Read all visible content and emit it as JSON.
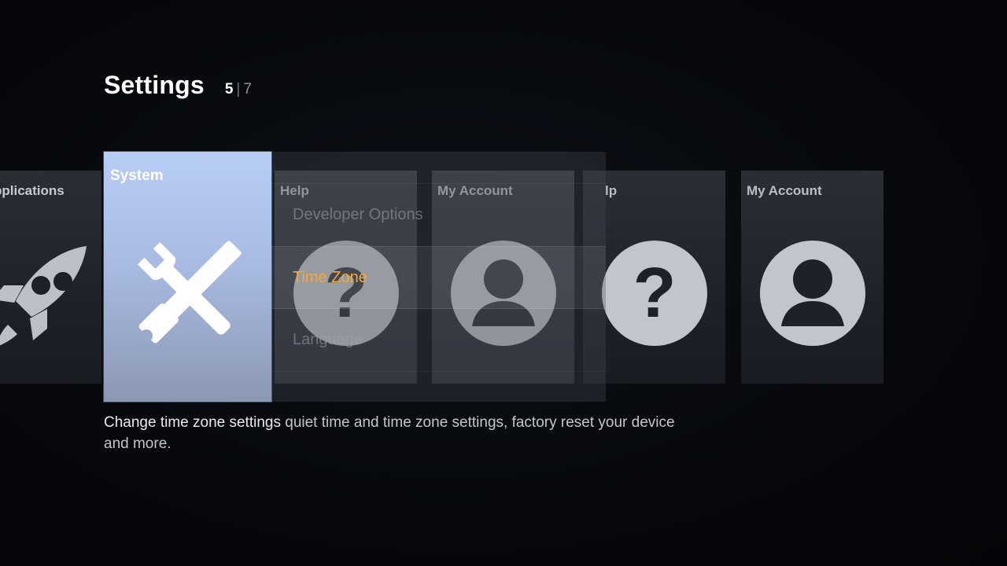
{
  "header": {
    "title": "Settings",
    "page_current": "5",
    "page_total": "7"
  },
  "tiles": {
    "applications": {
      "label": "pplications",
      "icon": "rocket-icon"
    },
    "system": {
      "label": "System",
      "icon": "tools-icon"
    },
    "help": {
      "label": "Help",
      "icon": "question-icon"
    },
    "my_account": {
      "label": "My Account",
      "icon": "user-icon"
    },
    "help_2": {
      "label": "lp",
      "icon": "question-icon"
    },
    "my_account_2": {
      "label": "My Account",
      "icon": "user-icon"
    }
  },
  "submenu": {
    "items": [
      {
        "label": "Developer Options"
      },
      {
        "label": "Time Zone",
        "selected": true
      },
      {
        "label": "Language"
      }
    ]
  },
  "description": {
    "lead": "Change time zone settings",
    "text": "quiet time and time zone settings, factory reset your device and more."
  },
  "colors": {
    "accent": "#f4a83c",
    "system_tile": "#b8cdf6",
    "background": "#06080c"
  }
}
